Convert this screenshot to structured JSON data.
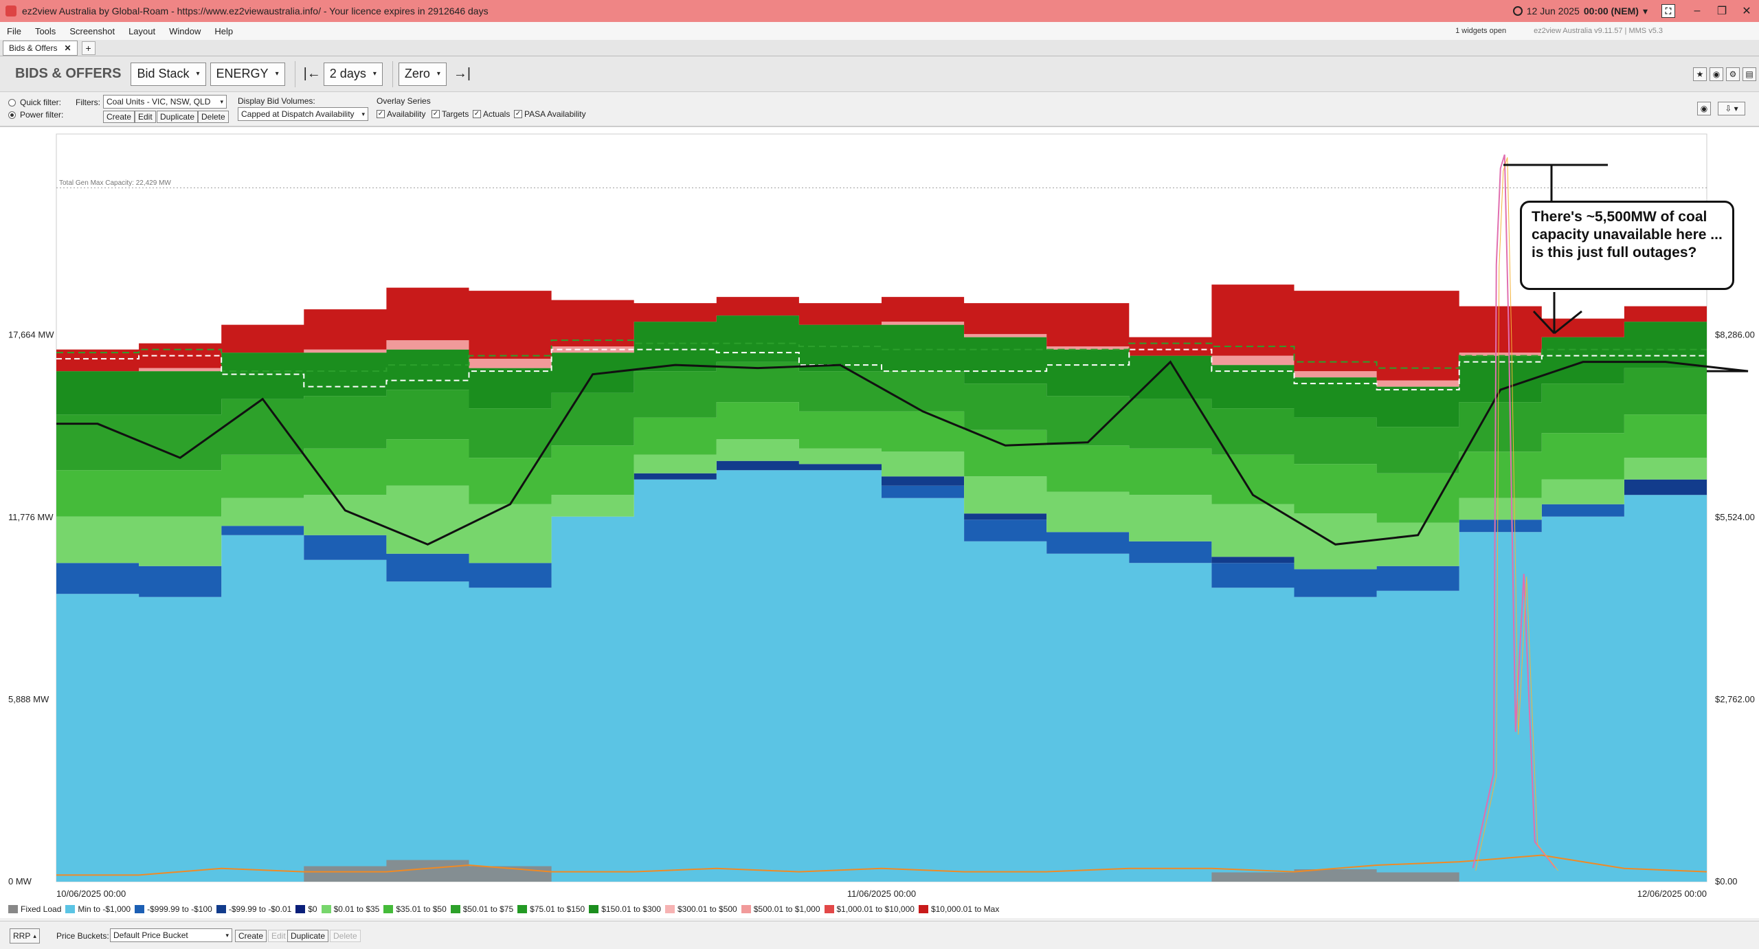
{
  "window": {
    "title": "ez2view Australia by Global-Roam - https://www.ez2viewaustralia.info/ - Your licence expires in 2912646 days",
    "clock_date": "12 Jun 2025",
    "clock_time": "00:00 (NEM)",
    "minimize": "–",
    "restore": "❐",
    "close": "✕",
    "mini_icon": "⛶"
  },
  "menu": {
    "items": [
      "File",
      "Tools",
      "Screenshot",
      "Layout",
      "Window",
      "Help"
    ],
    "widgets_open": "1 widgets open",
    "version": "ez2view Australia v9.11.57 | MMS v5.3"
  },
  "tabs": {
    "active": "Bids & Offers",
    "close": "✕",
    "add": "+"
  },
  "toolbar": {
    "section_title": "BIDS & OFFERS",
    "view": "Bid Stack",
    "market": "ENERGY",
    "start_arrow": "|←",
    "end_arrow": "→|",
    "period": "2 days",
    "baseline": "Zero",
    "caret": "▾"
  },
  "filters": {
    "quick_filter": "Quick filter:",
    "power_filter": "Power filter:",
    "filters_label": "Filters:",
    "filter_value": "Coal Units - VIC, NSW, QLD",
    "create": "Create",
    "edit": "Edit",
    "duplicate": "Duplicate",
    "delete": "Delete",
    "display_bid_volumes_label": "Display Bid Volumes:",
    "display_bid_volumes_value": "Capped at Dispatch Availability",
    "overlay_series_label": "Overlay Series",
    "overlay": [
      {
        "label": "Availability",
        "checked": true
      },
      {
        "label": "Targets",
        "checked": true
      },
      {
        "label": "Actuals",
        "checked": true
      },
      {
        "label": "PASA Availability",
        "checked": true
      }
    ],
    "check_mark": "✓"
  },
  "chart_data": {
    "type": "area",
    "title": "",
    "total_capacity_label": "Total Gen Max Capacity: 22,429 MW",
    "total_capacity": 22429,
    "y_left_ticks": [
      "17,664 MW",
      "11,776 MW",
      "5,888 MW",
      "0 MW"
    ],
    "y_left_values": [
      17664,
      11776,
      5888,
      0
    ],
    "y_right_ticks": [
      "$8,286.00",
      "$5,524.00",
      "$2,762.00",
      "$0.00"
    ],
    "y_right_values": [
      8286,
      5524,
      2762,
      0
    ],
    "ylim": [
      0,
      23500
    ],
    "x_ticks": [
      "10/06/2025 00:00",
      "11/06/2025 00:00",
      "12/06/2025 00:00"
    ],
    "x_hours": [
      0,
      3,
      6,
      9,
      12,
      15,
      18,
      21,
      24,
      27,
      30,
      33,
      36,
      39,
      42,
      45,
      48
    ],
    "grid": false,
    "legend_position": "bottom",
    "bands": [
      {
        "name": "Min to -$1,000",
        "color": "#5bc4e4",
        "values": [
          9300,
          9200,
          11200,
          10400,
          9700,
          9500,
          11800,
          13000,
          13300,
          13300,
          12400,
          11000,
          10600,
          10300,
          9500,
          9200,
          9400,
          11300,
          11800,
          12500,
          11900
        ]
      },
      {
        "name": "-$999.99 to -$100",
        "color": "#1c5fb4",
        "values": [
          1000,
          1000,
          300,
          800,
          900,
          800,
          0,
          0,
          0,
          0,
          400,
          700,
          700,
          700,
          800,
          900,
          800,
          400,
          400,
          0,
          700
        ]
      },
      {
        "name": "-$99.99 to -$0.01",
        "color": "#123c8c",
        "values": [
          0,
          0,
          0,
          0,
          0,
          0,
          0,
          200,
          300,
          200,
          300,
          200,
          0,
          0,
          200,
          0,
          0,
          0,
          0,
          500,
          200
        ]
      },
      {
        "name": "$0.01 to $35",
        "color": "#77d66c",
        "values": [
          1500,
          1600,
          900,
          1300,
          2200,
          1900,
          700,
          600,
          700,
          500,
          800,
          1200,
          1300,
          1500,
          1700,
          1800,
          1400,
          700,
          800,
          700,
          1400
        ]
      },
      {
        "name": "$35.01 to $50",
        "color": "#45bb3a",
        "values": [
          1500,
          1500,
          1400,
          1500,
          1500,
          1500,
          1600,
          1200,
          1200,
          1200,
          1300,
          1500,
          1500,
          1500,
          1600,
          1600,
          1600,
          1500,
          1500,
          1400,
          1400
        ]
      },
      {
        "name": "$50.01 to $75",
        "color": "#2da12a",
        "values": [
          1800,
          1800,
          1800,
          1700,
          1600,
          1600,
          1700,
          1500,
          1300,
          1300,
          1300,
          1500,
          1600,
          1600,
          1500,
          1500,
          1500,
          1600,
          1600,
          1500,
          1400
        ]
      },
      {
        "name": "$150.01 to $300",
        "color": "#1b8e1e",
        "values": [
          1400,
          1400,
          1500,
          1400,
          1300,
          1300,
          1300,
          1600,
          1500,
          1500,
          1500,
          1500,
          1500,
          1400,
          1400,
          1300,
          1300,
          1500,
          1500,
          1500,
          1500
        ]
      },
      {
        "name": "$500.01 to $1,000",
        "color": "#f19a9a",
        "values": [
          0,
          100,
          0,
          100,
          300,
          300,
          200,
          0,
          0,
          0,
          100,
          100,
          100,
          0,
          300,
          200,
          200,
          100,
          0,
          0,
          0
        ]
      },
      {
        "name": "$10,000.01 to Max",
        "color": "#c81a1a",
        "values": [
          700,
          800,
          900,
          1300,
          1700,
          2200,
          1500,
          600,
          600,
          700,
          800,
          1000,
          1400,
          600,
          2300,
          2600,
          2900,
          1500,
          600,
          500,
          600
        ]
      }
    ],
    "fixed_load": {
      "name": "Fixed Load",
      "color": "#888888",
      "values": [
        0,
        0,
        0,
        500,
        700,
        500,
        0,
        0,
        0,
        0,
        0,
        0,
        0,
        0,
        300,
        400,
        300,
        0,
        0,
        0,
        0
      ]
    },
    "availability": {
      "name": "Availability",
      "color": "#2ca02c",
      "values": [
        17100,
        17200,
        16500,
        16500,
        16700,
        17000,
        17500,
        17400,
        17400,
        17300,
        17200,
        17200,
        17200,
        17400,
        17300,
        16800,
        16600,
        17000,
        17200,
        17200,
        17200
      ]
    },
    "pasa_availability": {
      "name": "PASA Availability",
      "color": "#d62728",
      "values": [
        16900,
        17000,
        16400,
        16000,
        16200,
        16500,
        17200,
        17200,
        17100,
        16700,
        16500,
        16500,
        16700,
        17200,
        16500,
        16100,
        15900,
        16800,
        17000,
        17000,
        17000
      ]
    },
    "targets": {
      "name": "Targets",
      "color": "#111111",
      "values": [
        14800,
        13700,
        15600,
        12000,
        10900,
        12200,
        16400,
        16700,
        16600,
        16700,
        15200,
        14100,
        14200,
        16800,
        12500,
        10900,
        11200,
        15900,
        16800,
        16800,
        16500
      ]
    },
    "price": {
      "name": "RRP",
      "values": [
        100,
        100,
        200,
        150,
        150,
        250,
        150,
        150,
        200,
        150,
        200,
        150,
        150,
        200,
        200,
        150,
        250,
        300,
        400,
        200,
        150
      ]
    }
  },
  "legend": [
    {
      "label": "Fixed Load",
      "color": "#888888"
    },
    {
      "label": "Min to -$1,000",
      "color": "#5bc4e4"
    },
    {
      "label": "-$999.99 to -$100",
      "color": "#1c5fb4"
    },
    {
      "label": "-$99.99 to -$0.01",
      "color": "#123c8c"
    },
    {
      "label": "$0",
      "color": "#0a1f7a"
    },
    {
      "label": "$0.01 to $35",
      "color": "#77d66c"
    },
    {
      "label": "$35.01 to $50",
      "color": "#45bb3a"
    },
    {
      "label": "$50.01 to $75",
      "color": "#2da12a"
    },
    {
      "label": "$75.01 to $150",
      "color": "#239a24"
    },
    {
      "label": "$150.01 to $300",
      "color": "#1b8e1e"
    },
    {
      "label": "$300.01 to $500",
      "color": "#f6b3b3"
    },
    {
      "label": "$500.01 to $1,000",
      "color": "#f19a9a"
    },
    {
      "label": "$1,000.01 to $10,000",
      "color": "#e24848"
    },
    {
      "label": "$10,000.01 to Max",
      "color": "#c81a1a"
    }
  ],
  "callout": {
    "text": "There's ~5,500MW of coal capacity unavailable here ... is this just full outages?"
  },
  "bottom": {
    "rrp": "RRP",
    "rrp_caret": "▴",
    "price_buckets_label": "Price Buckets:",
    "price_buckets_value": "Default Price Bucket",
    "create": "Create",
    "edit": "Edit",
    "duplicate": "Duplicate",
    "delete": "Delete"
  }
}
